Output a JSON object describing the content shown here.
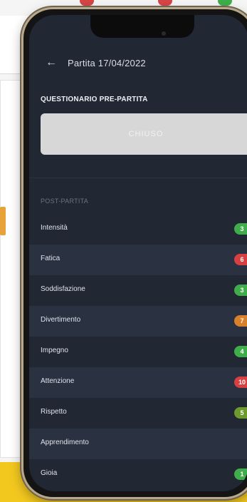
{
  "background": {
    "dot_colors": [
      "#d64545",
      "#d64545",
      "#3fae4a"
    ]
  },
  "header": {
    "back_icon": "arrow-left-icon",
    "title": "Partita 17/04/2022"
  },
  "pre_match": {
    "section_title": "QUESTIONARIO PRE-PARTITA",
    "status_button": "CHIUSO"
  },
  "post_match": {
    "section_title": "POST-PARTITA",
    "items": [
      {
        "label": "Intensità",
        "value": "3",
        "color": "#3fae4a"
      },
      {
        "label": "Fatica",
        "value": "6",
        "color": "#d64040"
      },
      {
        "label": "Soddisfazione",
        "value": "3",
        "color": "#3fae4a"
      },
      {
        "label": "Divertimento",
        "value": "7",
        "color": "#d9802a"
      },
      {
        "label": "Impegno",
        "value": "4",
        "color": "#3fae4a"
      },
      {
        "label": "Attenzione",
        "value": "10",
        "color": "#d64040"
      },
      {
        "label": "Rispetto",
        "value": "5",
        "color": "#6c9a2e"
      },
      {
        "label": "Apprendimento",
        "value": "",
        "color": ""
      },
      {
        "label": "Gioia",
        "value": "1",
        "color": "#3fae4a"
      }
    ]
  }
}
